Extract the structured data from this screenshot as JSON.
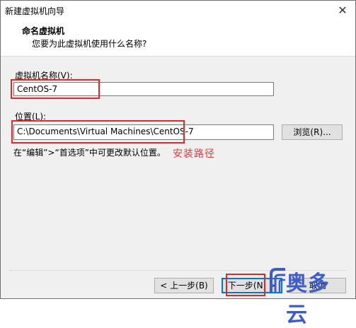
{
  "window": {
    "title": "新建虚拟机向导",
    "close_symbol": "✕"
  },
  "header": {
    "title": "命名虚拟机",
    "subtitle": "您要为此虚拟机使用什么名称?"
  },
  "name_field": {
    "label": "虚拟机名称(V):",
    "value": "CentOS-7"
  },
  "location_field": {
    "label": "位置(L):",
    "value": "C:\\Documents\\Virtual Machines\\CentOS-7",
    "browse_label": "浏览(R)..."
  },
  "hint": "在“编辑”>“首选项”中可更改默认位置。",
  "annotation": "安装路径",
  "footer": {
    "back_label": "< 上一步(B)",
    "next_label": "下一步(N) >",
    "cancel_label": "取消"
  },
  "watermark": {
    "text": "奥多云",
    "color": "#3d5cc7"
  },
  "colors": {
    "highlight_box": "#e0282a",
    "annotation_text": "#e03c3c",
    "primary_border": "#0078d7"
  }
}
